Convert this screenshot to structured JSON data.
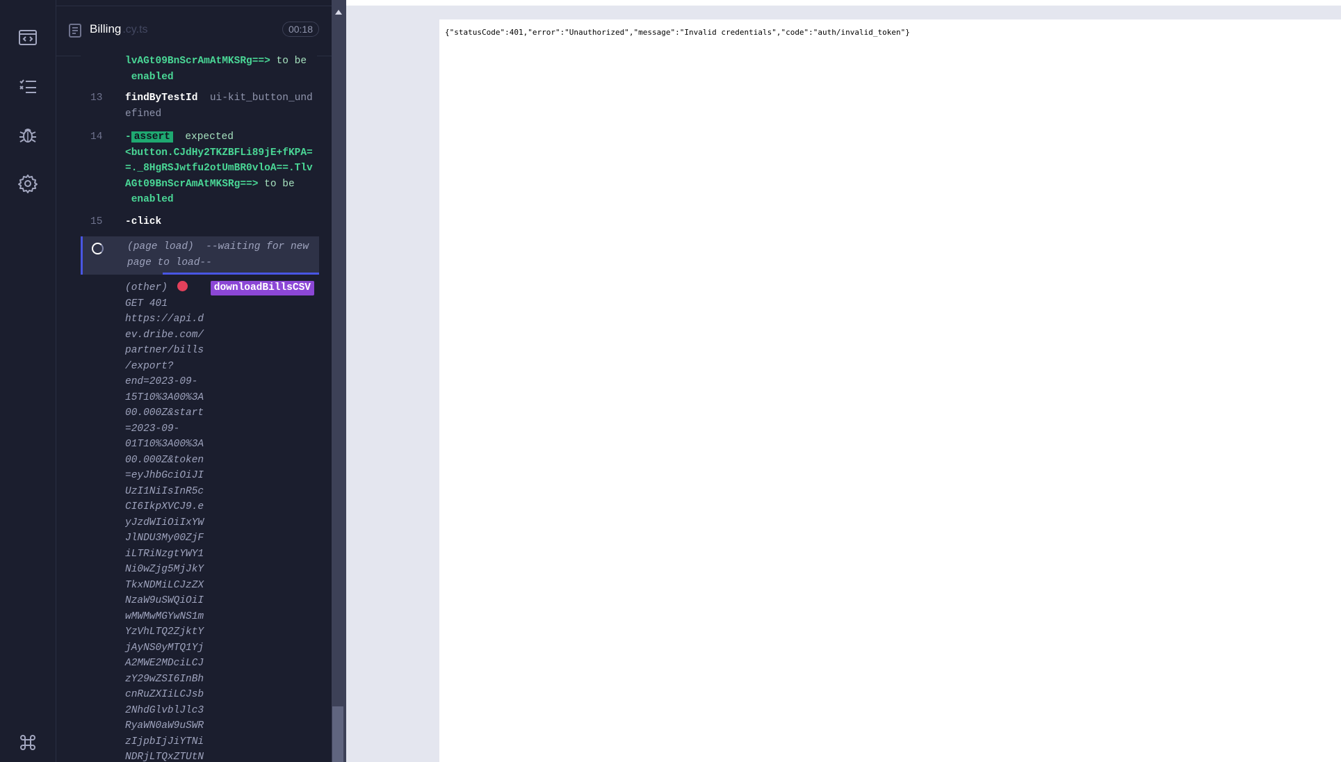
{
  "sidebar": {
    "items": [
      {
        "icon": "code-window-icon"
      },
      {
        "icon": "test-list-icon"
      },
      {
        "icon": "bug-icon"
      },
      {
        "icon": "gear-icon"
      }
    ],
    "bottom_icon": "command-key-icon"
  },
  "spec": {
    "name": "Billing",
    "ext": ".cy.ts",
    "duration": "00:18"
  },
  "log": {
    "prev_tail_line1": "lvAGt09BnScrAmAtMKSRg==>",
    "prev_tail_to_be": "to be",
    "prev_tail_enabled": "enabled",
    "cmd13": {
      "number": "13",
      "name": "findByTestId",
      "arg": "ui-kit_button_undefined"
    },
    "cmd14": {
      "number": "14",
      "dash": "-",
      "name": "assert",
      "expected": "expected",
      "subject": "<button.CJdHy2TKZBFLi89jE+fKPA==._8HgRSJwtfu2otUmBR0vloA==.TlvAGt09BnScrAmAtMKSRg==>",
      "to_be": "to be",
      "enabled": "enabled"
    },
    "cmd15": {
      "number": "15",
      "name": "-click"
    },
    "page_load": {
      "label": "(page load)",
      "message": "--waiting for new page to load--"
    },
    "request": {
      "type": "(other)",
      "alias": "downloadBillsCSV",
      "method_status": "GET 401",
      "url": "https://api.d\nev.dribe.com/\npartner/bills\n/export?\nend=2023-09-\n15T10%3A00%3A\n00.000Z&start\n=2023-09-\n01T10%3A00%3A\n00.000Z&token\n=eyJhbGciOiJI\nUzI1NiIsInR5c\nCI6IkpXVCJ9.e\nyJzdWIiOiIxYW\nJlNDU3My00ZjF\niLTRiNzgtYWY1\nNi0wZjg5MjJkY\nTkxNDMiLCJzZX\nNzaW9uSWQiOiI\nwMWMwMGYwNS1m\nYzVhLTQ2ZjktY\njAyNS0yMTQ1Yj\nA2MWE2MDciLCJ\nzY29wZSI6InBh\ncnRuZXIiLCJsb\n2NhdGlvblJlc3\nRyaWN0aW9uSWR\nzIjpbIjJiYTNi\nNDRjLTQxZTUtN"
    }
  },
  "preview": {
    "response": "{\"statusCode\":401,\"error\":\"Unauthorized\",\"message\":\"Invalid credentials\",\"code\":\"auth/invalid_token\"}"
  }
}
